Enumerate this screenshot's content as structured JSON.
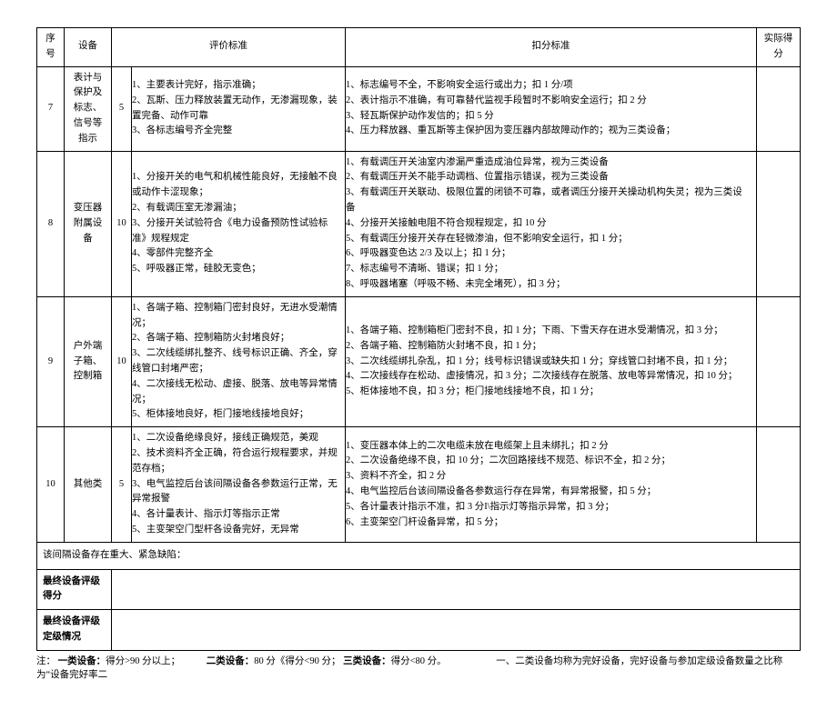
{
  "headers": {
    "seq": "序号",
    "dev": "设备",
    "eval": "评价标准",
    "ded": "扣分标准",
    "score": "实际得分"
  },
  "rows": [
    {
      "seq": "7",
      "dev": "表计与保护及标志、信号等指示",
      "wt": "5",
      "eval": "1、主要表计完好，指示准确；\n2、瓦斯、压力释放装置无动作，无渗漏现象，装置完备、动作可靠\n3、各标志编号齐全完整",
      "ded": "1、标志编号不全，不影响安全运行或出力；扣 1 分/项\n2、表计指示不准确，有可靠替代监视手段暂时不影响安全运行；扣 2 分\n3、轻瓦斯保护动作发信的；扣 5 分\n4、压力释放器、重瓦斯等主保护因为变压器内部故障动作的；视为三类设备；"
    },
    {
      "seq": "8",
      "dev": "变压器附属设备",
      "wt": "10",
      "eval": "1、分接开关的电气和机械性能良好，无接触不良或动作卡涩现象；\n2、有载调压室无渗漏油；\n3、分接开关试验符合《电力设备预防性试验标准》规程规定\n4、零部件完整齐全\n5、呼吸器正常，硅胶无变色；",
      "ded": "1、有载调压开关油室内渗漏严重造成油位异常，视为三类设备\n2、有载调压开关不能手动调档、位置指示错误，视为三类设备\n3、有载调压开关联动、极限位置的闭锁不可靠，或者调压分接开关操动机构失灵；视为三类设备\n4、分接开关接触电阻不符合规程规定，扣 10 分\n5、有载调压分接开关存在轻微渗油，但不影响安全运行，扣 1 分；\n6、呼吸器变色达 2/3 及以上；扣 1 分；\n7、标志编号不清晰、错误；扣 1 分；\n8、呼吸器堵塞（呼吸不畅、未完全堵死），扣 3 分；"
    },
    {
      "seq": "9",
      "dev": "户外端子箱、控制箱",
      "wt": "10",
      "eval": "1、各端子箱、控制箱门密封良好，无进水受潮情况；\n2、各端子箱、控制箱防火封堵良好；\n3、二次线缆绑扎整齐、线号标识正确、齐全，穿线管口封堵严密；\n4、二次接线无松动、虚接、脱落、放电等异常情况；\n5、柜体接地良好，柜门接地线接地良好；",
      "ded": "1、各端子箱、控制箱柜门密封不良，扣 1 分；下雨、下雪天存在进水受潮情况，扣 3 分；\n2、各端子箱、控制箱防火封堵不良，扣 1 分；\n3、二次线缆绑扎杂乱，扣 1 分；线号标识错误或缺失扣 1 分；穿线管口封堵不良，扣 1 分；\n4、二次接线存在松动、虚接情况，扣 3 分；二次接线存在脱落、放电等异常情况，扣 10 分；\n5、柜体接地不良，扣 3 分；柜门接地线接地不良，扣 1 分；"
    },
    {
      "seq": "10",
      "dev": "其他类",
      "wt": "5",
      "eval": "1、二次设备绝缘良好，接线正确规范，美观\n2、技术资料齐全正确，符合运行规程要求，并规范存档；\n3、电气监控后台该间隔设备各参数运行正常，无异常报警\n4、各计量表计、指示灯等指示正常\n5、主变架空门型杆各设备完好，无异常",
      "ded": "1、变压器本体上的二次电缆未放在电缆架上且未绑扎；扣 2 分\n2、二次设备绝缘不良，扣 10 分；二次回路接线不规范、标识不全，扣 2 分；\n3、资料不齐全，扣 2 分\n4、电气监控后台该间隔设备各参数运行存在异常，有异常报警，扣 5 分；\n5、各计量表计指示不准，扣 3 分I\\指示灯等指示异常，扣 3 分；\n6、主变架空门杆设备异常，扣 5 分；"
    }
  ],
  "defect_row": "该间隔设备存在重大、紧急缺陷：",
  "final_score": "最终设备评级得分",
  "final_grade": "最终设备评级定级情况",
  "note_prefix": "注：",
  "note_c1": "一类设备：",
  "note_c1v": "得分>90 分以上；",
  "note_c2": "二类设备：",
  "note_c2v": "80 分《得分<90 分；",
  "note_c3": "三类设备：",
  "note_c3v": "得分<80 分。",
  "note_tail": "一、二类设备均称为完好设备，完好设备与参加定级设备数量之比称为“设备完好率二"
}
